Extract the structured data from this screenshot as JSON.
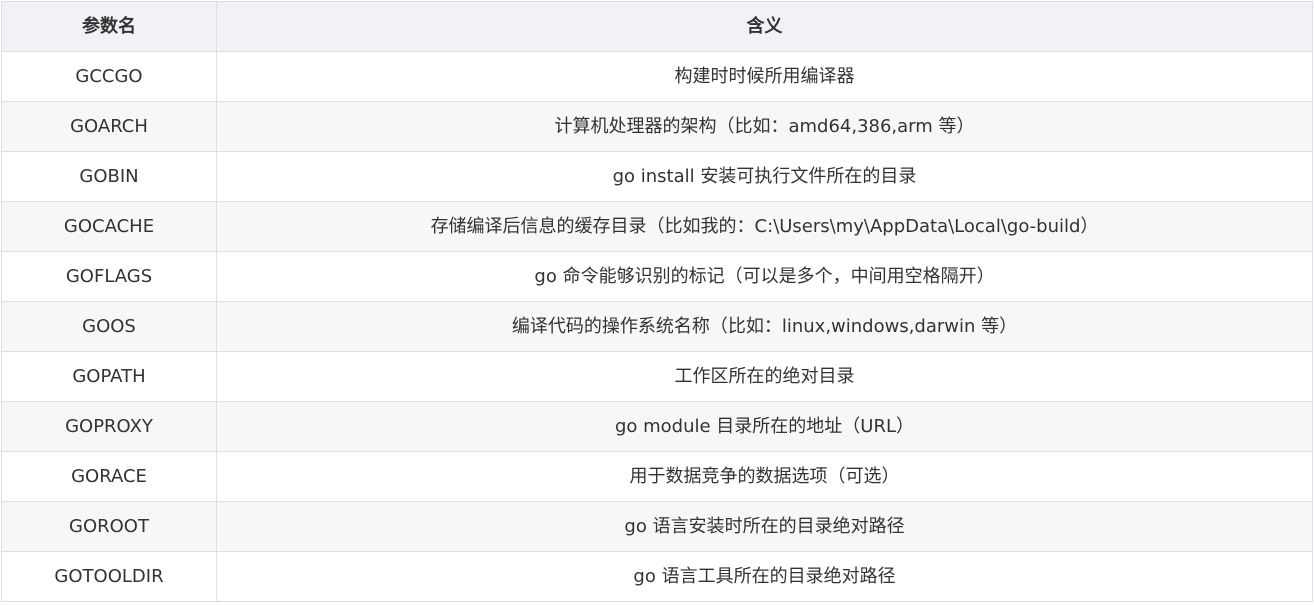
{
  "table": {
    "headers": [
      "参数名",
      "含义"
    ],
    "rows": [
      [
        "GCCGO",
        "构建时时候所用编译器"
      ],
      [
        "GOARCH",
        "计算机处理器的架构（比如：amd64,386,arm 等）"
      ],
      [
        "GOBIN",
        "go install 安装可执行文件所在的目录"
      ],
      [
        "GOCACHE",
        "存储编译后信息的缓存目录（比如我的：C:\\Users\\my\\AppData\\Local\\go-build）"
      ],
      [
        "GOFLAGS",
        "go 命令能够识别的标记（可以是多个，中间用空格隔开）"
      ],
      [
        "GOOS",
        "编译代码的操作系统名称（比如：linux,windows,darwin 等）"
      ],
      [
        "GOPATH",
        "工作区所在的绝对目录"
      ],
      [
        "GOPROXY",
        "go module 目录所在的地址（URL）"
      ],
      [
        "GORACE",
        "用于数据竞争的数据选项（可选）"
      ],
      [
        "GOROOT",
        "go 语言安装时所在的目录绝对路径"
      ],
      [
        "GOTOOLDIR",
        "go 语言工具所在的目录绝对路径"
      ]
    ]
  }
}
